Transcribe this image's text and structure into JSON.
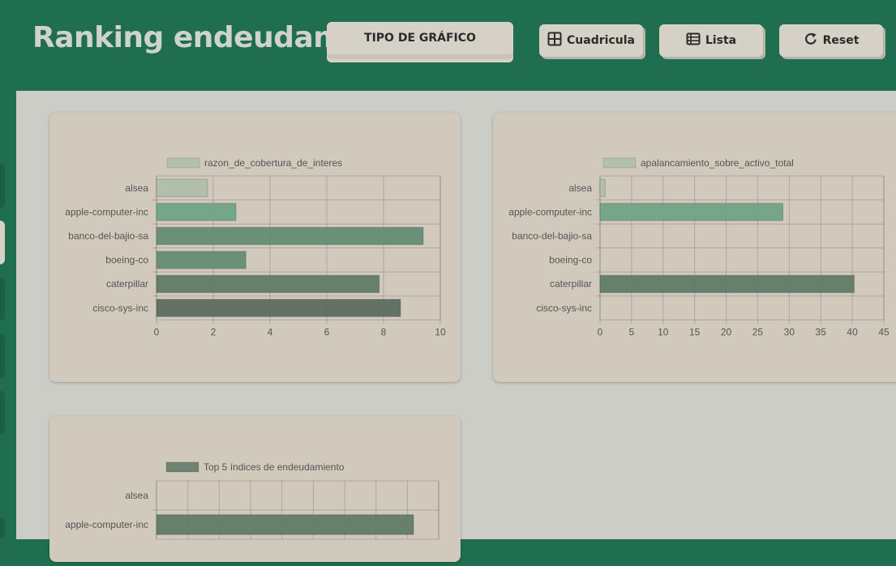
{
  "header": {
    "title": "Ranking endeudamiento",
    "chart_type_label": "TIPO DE GRÁFICO",
    "buttons": [
      {
        "label": "Cuadricula",
        "icon": "grid-icon"
      },
      {
        "label": "Lista",
        "icon": "list-icon"
      },
      {
        "label": "Reset",
        "icon": "reset-icon"
      }
    ]
  },
  "colors": {
    "header_bg": "#1e6e4f",
    "content_bg": "#cccdc7",
    "card_bg": "#d0c9bc",
    "button_bg": "#d6d1c7"
  },
  "chart_data": [
    {
      "type": "bar",
      "orientation": "horizontal",
      "categories": [
        "alsea",
        "apple-computer-inc",
        "banco-del-bajio-sa",
        "boeing-co",
        "caterpillar",
        "cisco-sys-inc"
      ],
      "series": [
        {
          "name": "razon_de_cobertura_de_interes",
          "values": [
            1.8,
            2.8,
            9.4,
            3.15,
            7.85,
            8.6
          ]
        }
      ],
      "xlim": [
        0,
        10
      ],
      "xticks": [
        0,
        2,
        4,
        6,
        8,
        10
      ],
      "bar_colors": [
        "#aebfa9",
        "#6aa286",
        "#5f8a72",
        "#5f8a72",
        "#5d7765",
        "#58685c"
      ],
      "legend_color": "#aebfa9",
      "grid": true,
      "legend_position": "top"
    },
    {
      "type": "bar",
      "orientation": "horizontal",
      "categories": [
        "alsea",
        "apple-computer-inc",
        "banco-del-bajio-sa",
        "boeing-co",
        "caterpillar",
        "cisco-sys-inc"
      ],
      "series": [
        {
          "name": "apalancamiento_sobre_activo_total",
          "values": [
            0.8,
            29,
            0,
            0,
            40.3,
            0
          ]
        }
      ],
      "xlim": [
        0,
        45
      ],
      "xticks": [
        0,
        5,
        10,
        15,
        20,
        25,
        30,
        35,
        40,
        45
      ],
      "bar_colors": [
        "#aebfa9",
        "#6aa286",
        "#5f8a72",
        "#5f8a72",
        "#5d7765",
        "#58685c"
      ],
      "legend_color": "#aebfa9",
      "grid": true,
      "legend_position": "top"
    },
    {
      "type": "bar",
      "orientation": "horizontal",
      "categories": [
        "alsea",
        "apple-computer-inc"
      ],
      "series": [
        {
          "name": "Top 5 índices de endeudamiento",
          "values": [
            0,
            41
          ]
        }
      ],
      "xlim": [
        0,
        45
      ],
      "bar_colors": [
        "#5d7765",
        "#5d7765"
      ],
      "legend_color": "#5d7765",
      "grid": true,
      "legend_position": "top"
    }
  ]
}
